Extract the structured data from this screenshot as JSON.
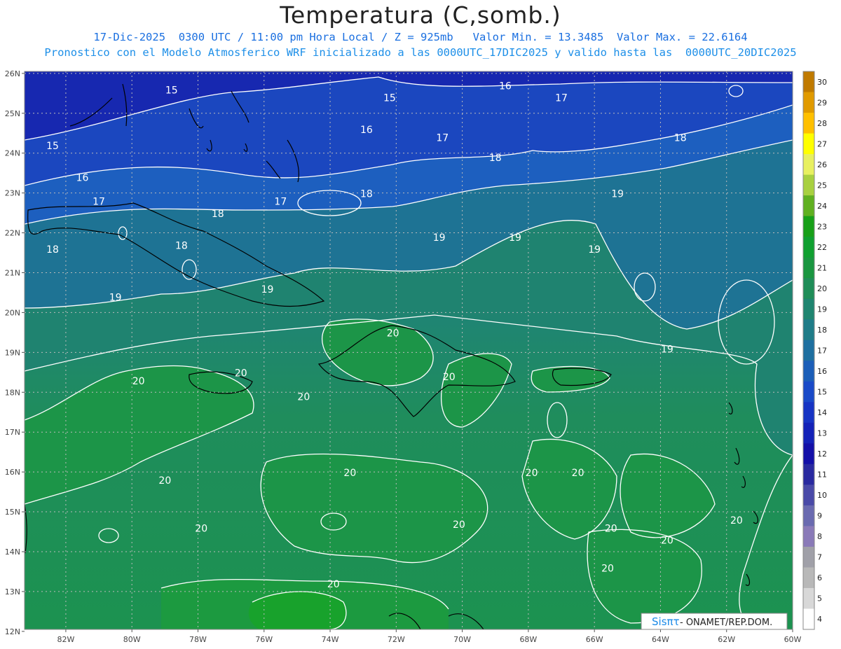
{
  "title": "Temperatura (C,somb.)",
  "subtitle_line1": "17-Dic-2025  0300 UTC / 11:00 pm Hora Local / Z = 925mb   Valor Min. = 13.3485  Valor Max. = 22.6164",
  "subtitle_line2": "Pronostico con el Modelo Atmosferico WRF inicializado a las 0000UTC_17DIC2025 y valido hasta las  0000UTC_20DIC2025",
  "lat_labels": [
    "26N",
    "25N",
    "24N",
    "23N",
    "22N",
    "21N",
    "20N",
    "19N",
    "18N",
    "17N",
    "16N",
    "15N",
    "14N",
    "13N",
    "12N"
  ],
  "lon_labels": [
    "82W",
    "80W",
    "78W",
    "76W",
    "74W",
    "72W",
    "70W",
    "68W",
    "66W",
    "64W",
    "62W",
    "60W"
  ],
  "colorbar_labels": [
    "30",
    "29",
    "28",
    "27",
    "26",
    "25",
    "24",
    "23",
    "22",
    "21",
    "20",
    "19",
    "18",
    "17",
    "16",
    "15",
    "14",
    "13",
    "12",
    "11",
    "10",
    "9",
    "8",
    "7",
    "6",
    "5",
    "4"
  ],
  "colorbar_colors": [
    "#c07a00",
    "#e09a00",
    "#ffc000",
    "#ffff00",
    "#e8f060",
    "#a8d040",
    "#60b020",
    "#18a018",
    "#10a030",
    "#1a9640",
    "#1f8d58",
    "#1f8570",
    "#1f7c88",
    "#1e6fa0",
    "#1c5eb8",
    "#1a4ac8",
    "#1734c4",
    "#1422b8",
    "#1410a8",
    "#2a2aa0",
    "#4a4aa8",
    "#6a6ab0",
    "#8a7ab8",
    "#a0a0a8",
    "#b8b8b8",
    "#d8d8d8",
    "#ffffff"
  ],
  "contour_labels": [
    {
      "text": "15",
      "lon": -78.8,
      "lat": 25.5
    },
    {
      "text": "15",
      "lon": -82.4,
      "lat": 24.1
    },
    {
      "text": "15",
      "lon": -72.2,
      "lat": 25.3
    },
    {
      "text": "16",
      "lon": -68.7,
      "lat": 25.6
    },
    {
      "text": "16",
      "lon": -72.9,
      "lat": 24.5
    },
    {
      "text": "16",
      "lon": -81.5,
      "lat": 23.3
    },
    {
      "text": "17",
      "lon": -81.0,
      "lat": 22.7
    },
    {
      "text": "17",
      "lon": -75.5,
      "lat": 22.7
    },
    {
      "text": "17",
      "lon": -70.6,
      "lat": 24.3
    },
    {
      "text": "17",
      "lon": -67.0,
      "lat": 25.3
    },
    {
      "text": "18",
      "lon": -77.4,
      "lat": 22.4
    },
    {
      "text": "18",
      "lon": -78.5,
      "lat": 21.6
    },
    {
      "text": "18",
      "lon": -82.4,
      "lat": 21.5
    },
    {
      "text": "18",
      "lon": -72.9,
      "lat": 22.9
    },
    {
      "text": "18",
      "lon": -69.0,
      "lat": 23.8
    },
    {
      "text": "18",
      "lon": -63.4,
      "lat": 24.3
    },
    {
      "text": "19",
      "lon": -80.5,
      "lat": 20.3
    },
    {
      "text": "19",
      "lon": -75.9,
      "lat": 20.5
    },
    {
      "text": "19",
      "lon": -70.7,
      "lat": 21.8
    },
    {
      "text": "19",
      "lon": -68.4,
      "lat": 21.8
    },
    {
      "text": "19",
      "lon": -66.0,
      "lat": 21.5
    },
    {
      "text": "19",
      "lon": -65.3,
      "lat": 22.9
    },
    {
      "text": "19",
      "lon": -63.8,
      "lat": 19.0
    },
    {
      "text": "20",
      "lon": -72.1,
      "lat": 19.4
    },
    {
      "text": "20",
      "lon": -76.7,
      "lat": 18.4
    },
    {
      "text": "20",
      "lon": -79.8,
      "lat": 18.2
    },
    {
      "text": "20",
      "lon": -74.8,
      "lat": 17.8
    },
    {
      "text": "20",
      "lon": -70.4,
      "lat": 18.3
    },
    {
      "text": "20",
      "lon": -79.0,
      "lat": 15.7
    },
    {
      "text": "20",
      "lon": -73.4,
      "lat": 15.9
    },
    {
      "text": "20",
      "lon": -70.1,
      "lat": 14.6
    },
    {
      "text": "20",
      "lon": -67.9,
      "lat": 15.9
    },
    {
      "text": "20",
      "lon": -66.5,
      "lat": 15.9
    },
    {
      "text": "20",
      "lon": -77.9,
      "lat": 14.5
    },
    {
      "text": "20",
      "lon": -65.5,
      "lat": 14.5
    },
    {
      "text": "20",
      "lon": -63.8,
      "lat": 14.2
    },
    {
      "text": "20",
      "lon": -61.7,
      "lat": 14.7
    },
    {
      "text": "20",
      "lon": -65.6,
      "lat": 13.5
    },
    {
      "text": "20",
      "lon": -73.9,
      "lat": 13.1
    }
  ],
  "footer_logo": "Sisπτ",
  "footer_text": " - ONAMET/REP.DOM."
}
